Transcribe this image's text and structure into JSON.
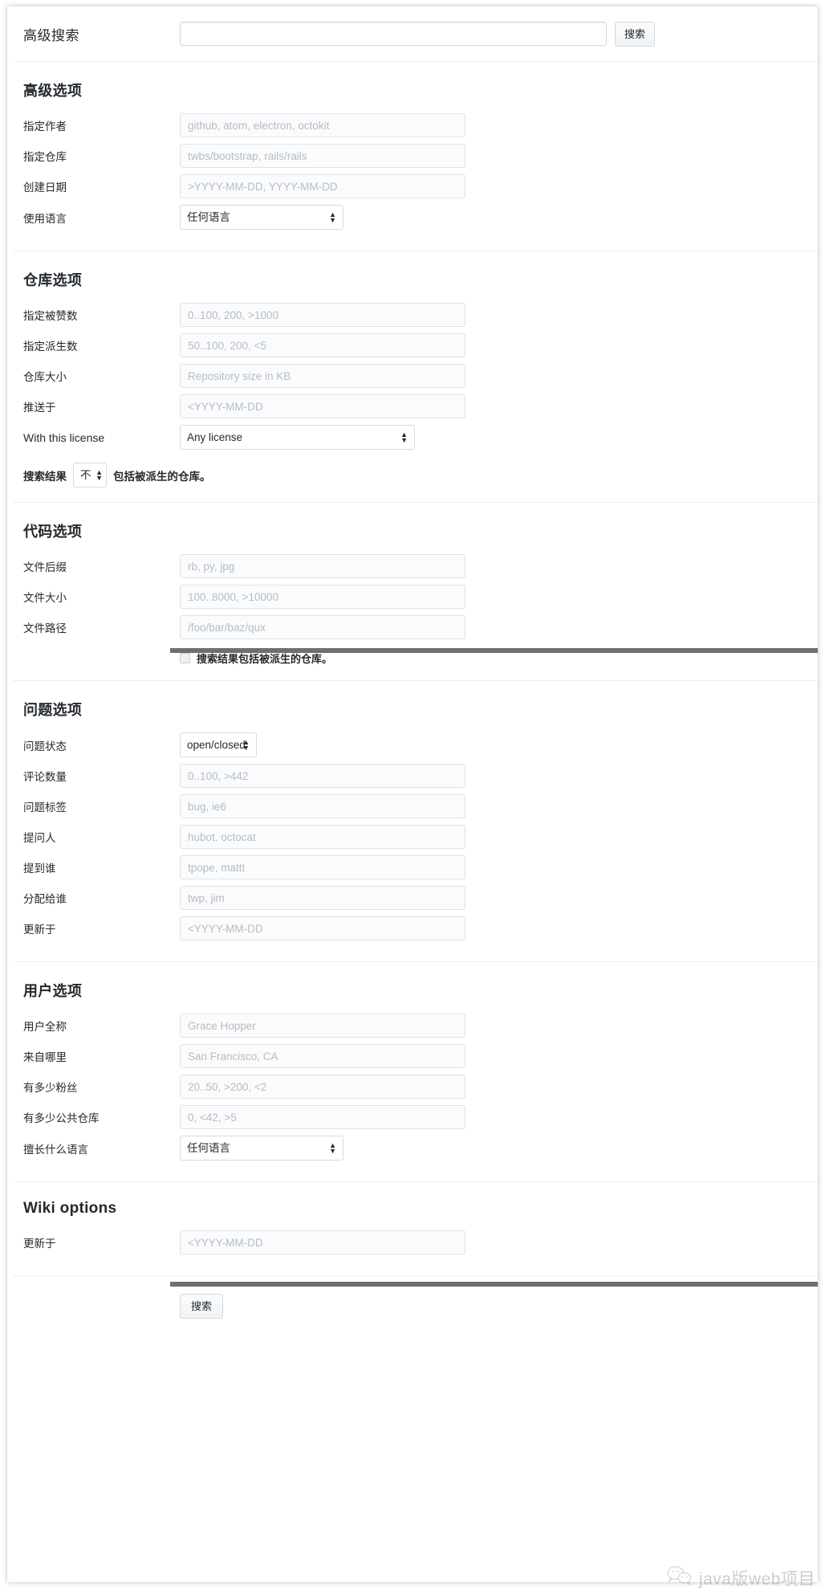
{
  "header": {
    "title": "高级搜索",
    "query_value": "",
    "query_placeholder": "",
    "search_button": "搜索"
  },
  "sections": [
    {
      "id": "advanced-options",
      "title": "高级选项",
      "fields": [
        {
          "label": "指定作者",
          "type": "text",
          "placeholder": "github, atom, electron, octokit"
        },
        {
          "label": "指定仓库",
          "type": "text",
          "placeholder": "twbs/bootstrap, rails/rails"
        },
        {
          "label": "创建日期",
          "type": "text",
          "placeholder": ">YYYY-MM-DD, YYYY-MM-DD"
        },
        {
          "label": "使用语言",
          "type": "select",
          "value": "任何语言"
        }
      ]
    },
    {
      "id": "repository-options",
      "title": "仓库选项",
      "fields": [
        {
          "label": "指定被赞数",
          "type": "text",
          "placeholder": "0..100, 200, >1000"
        },
        {
          "label": "指定派生数",
          "type": "text",
          "placeholder": "50..100, 200, <5"
        },
        {
          "label": "仓库大小",
          "type": "text",
          "placeholder": "Repository size in KB"
        },
        {
          "label": "推送于",
          "type": "text",
          "placeholder": "<YYYY-MM-DD"
        },
        {
          "label": "With this license",
          "type": "select",
          "value": "Any license"
        }
      ],
      "fork_line": {
        "prefix": "搜索结果",
        "select_value": "不",
        "suffix": "包括被派生的仓库。"
      }
    },
    {
      "id": "code-options",
      "title": "代码选项",
      "fields": [
        {
          "label": "文件后缀",
          "type": "text",
          "placeholder": "rb, py, jpg"
        },
        {
          "label": "文件大小",
          "type": "text",
          "placeholder": "100..8000, >10000"
        },
        {
          "label": "文件路径",
          "type": "text",
          "placeholder": "/foo/bar/baz/qux"
        }
      ],
      "checkbox": {
        "label": "搜索结果包括被派生的仓库。",
        "checked": false
      }
    },
    {
      "id": "issue-options",
      "title": "问题选项",
      "fields": [
        {
          "label": "问题状态",
          "type": "select",
          "value": "open/closed"
        },
        {
          "label": "评论数量",
          "type": "text",
          "placeholder": "0..100, >442"
        },
        {
          "label": "问题标签",
          "type": "text",
          "placeholder": "bug, ie6"
        },
        {
          "label": "提问人",
          "type": "text",
          "placeholder": "hubot, octocat"
        },
        {
          "label": "提到谁",
          "type": "text",
          "placeholder": "tpope, mattt"
        },
        {
          "label": "分配给谁",
          "type": "text",
          "placeholder": "twp, jim"
        },
        {
          "label": "更新于",
          "type": "text",
          "placeholder": "<YYYY-MM-DD"
        }
      ]
    },
    {
      "id": "user-options",
      "title": "用户选项",
      "fields": [
        {
          "label": "用户全称",
          "type": "text",
          "placeholder": "Grace Hopper"
        },
        {
          "label": "来自哪里",
          "type": "text",
          "placeholder": "San Francisco, CA"
        },
        {
          "label": "有多少粉丝",
          "type": "text",
          "placeholder": "20..50, >200, <2"
        },
        {
          "label": "有多少公共仓库",
          "type": "text",
          "placeholder": "0, <42, >5"
        },
        {
          "label": "擅长什么语言",
          "type": "select",
          "value": "任何语言"
        }
      ]
    },
    {
      "id": "wiki-options",
      "title": "Wiki options",
      "fields": [
        {
          "label": "更新于",
          "type": "text",
          "placeholder": "<YYYY-MM-DD"
        }
      ]
    }
  ],
  "footer": {
    "submit_label": "搜索"
  },
  "watermark": {
    "text": "java版web项目",
    "icon": "wechat-icon"
  },
  "colors": {
    "text": "#24292e",
    "placeholder": "#b6bcc2",
    "border": "#e0e2e5",
    "divider": "#eaecef",
    "input_bg": "#fafbfc",
    "scanbar": "#6f6f6f"
  }
}
